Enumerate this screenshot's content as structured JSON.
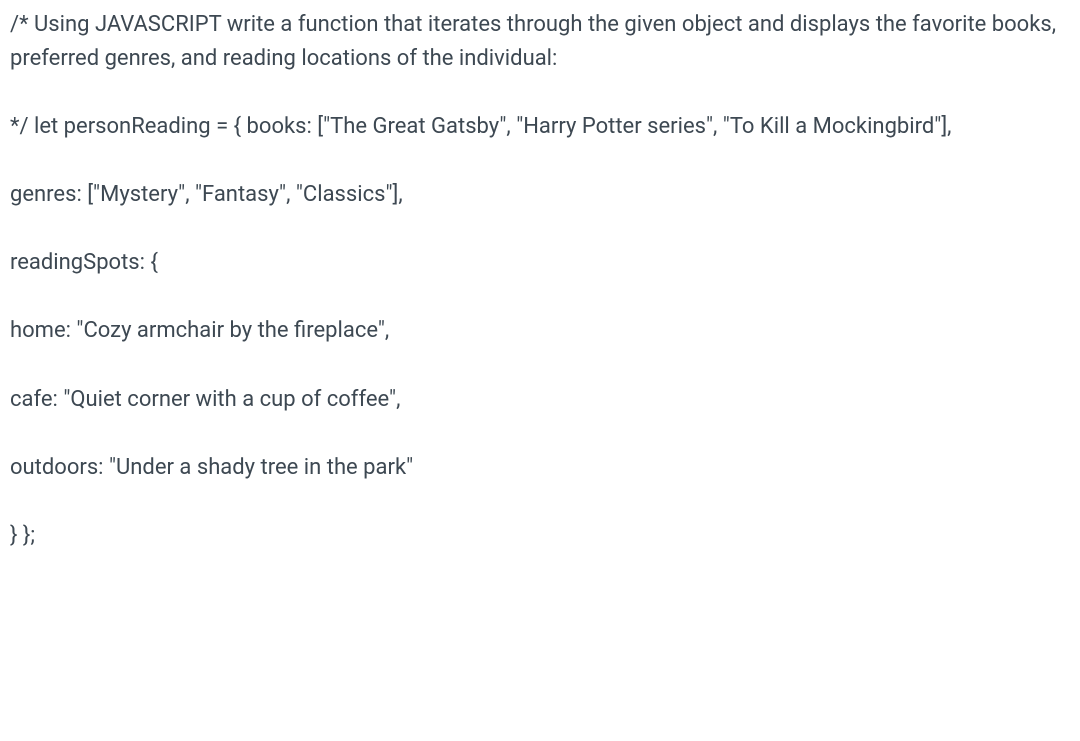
{
  "lines": {
    "l1": "/* Using JAVASCRIPT write a function that iterates through the given object and displays the favorite books, preferred genres, and reading locations of the individual:",
    "l2": "*/ let personReading = { books: [\"The Great Gatsby\", \"Harry Potter series\", \"To Kill a Mockingbird\"],",
    "l3": "genres: [\"Mystery\", \"Fantasy\", \"Classics\"],",
    "l4": "readingSpots: {",
    "l5": "home: \"Cozy armchair by the fireplace\",",
    "l6": "cafe: \"Quiet corner with a cup of coffee\",",
    "l7": "outdoors: \"Under a shady tree in the park\"",
    "l8": "} };"
  }
}
